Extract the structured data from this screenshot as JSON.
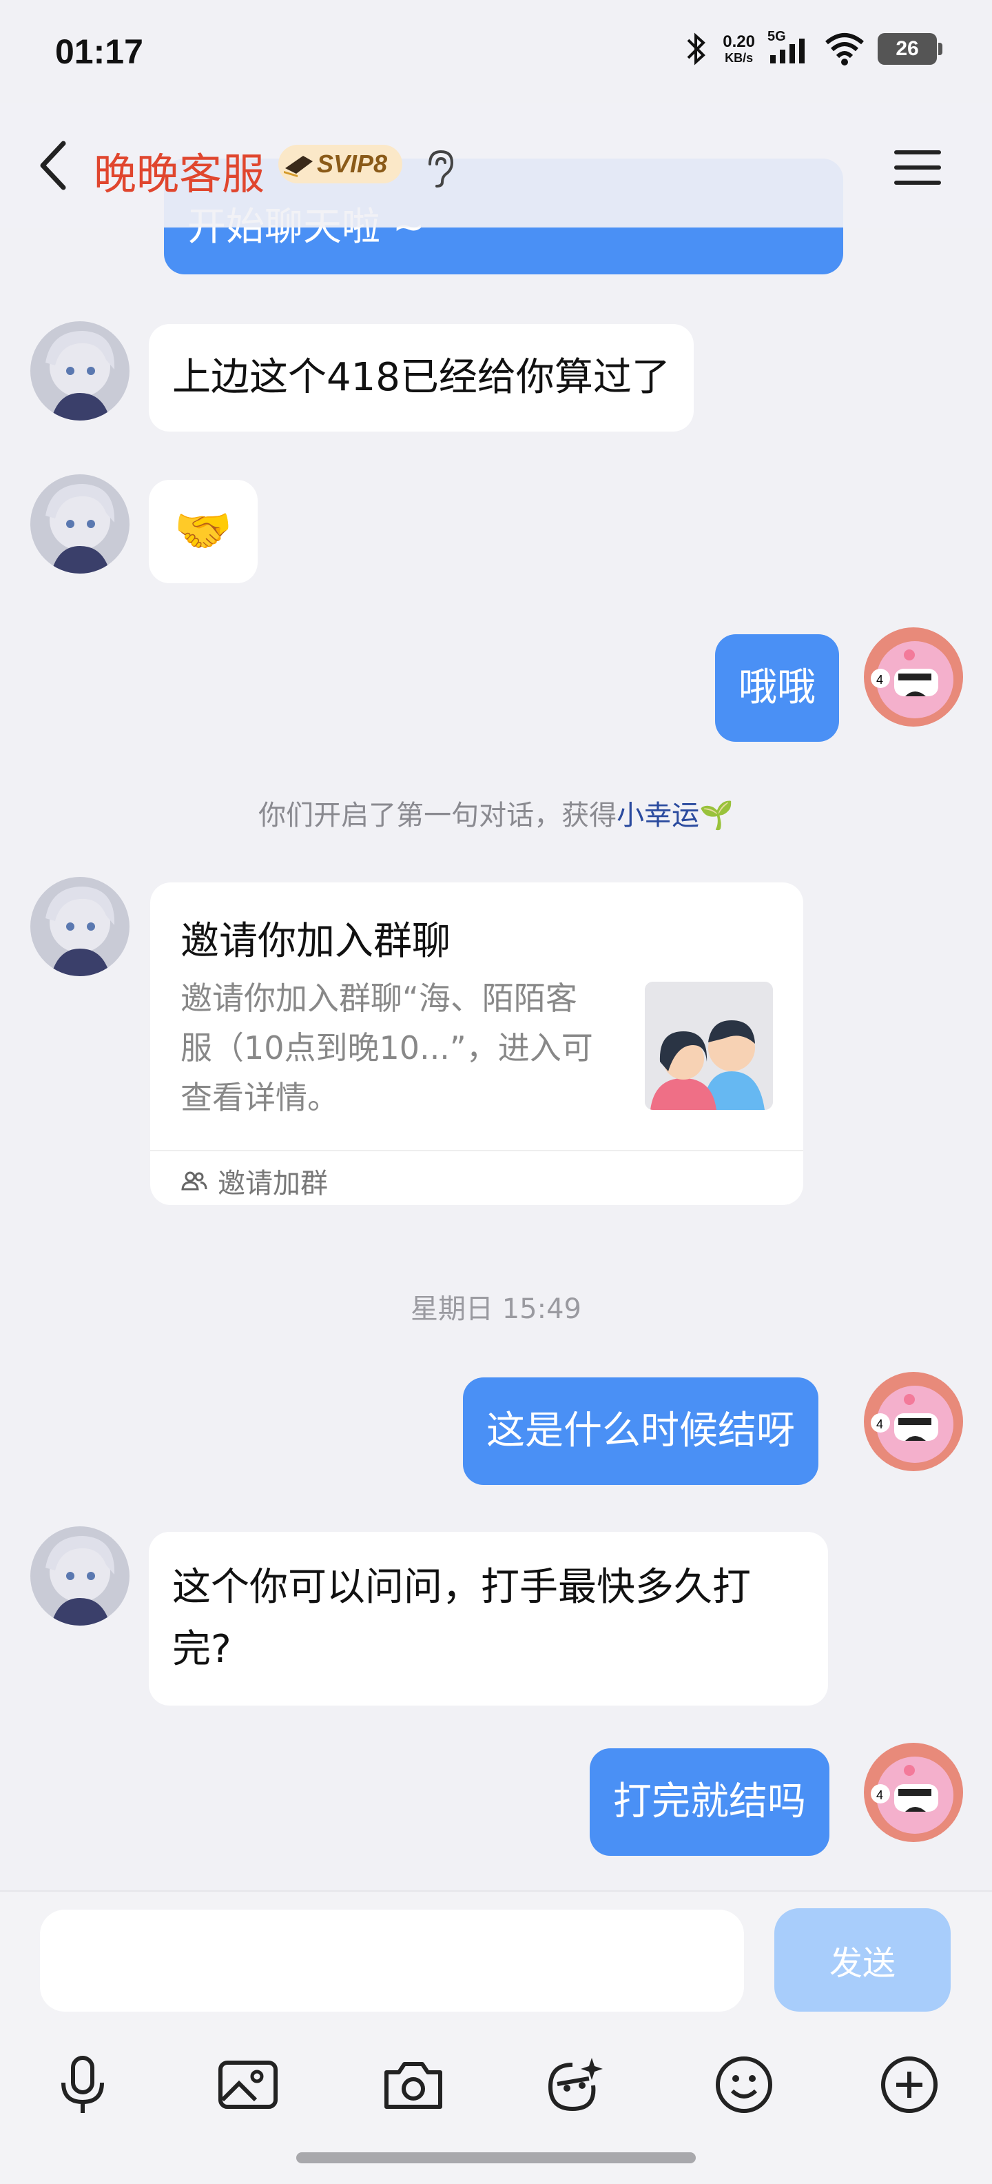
{
  "status": {
    "time": "01:17",
    "net_speed_value": "0.20",
    "net_speed_unit": "KB/s",
    "network": "5G",
    "battery": "26"
  },
  "header": {
    "title": "晚晚客服",
    "badge": "SVIP8"
  },
  "messages": {
    "cut_off": "开始聊天啦 ~",
    "m1": "上边这个418已经给你算过了",
    "m2_emoji": "🤝",
    "m3": "哦哦",
    "system_text": "你们开启了第一句对话，获得",
    "system_lucky": "小幸运",
    "system_emoji": "🌱",
    "card": {
      "title": "邀请你加入群聊",
      "desc": "邀请你加入群聊“海、陌陌客服（10点到晚10...”，进入可查看详情。",
      "footer": "邀请加群"
    },
    "timestamp": "星期日 15:49",
    "m4": "这是什么时候结呀",
    "m5": "这个你可以问问，打手最快多久打完?",
    "m6": "打完就结吗"
  },
  "input": {
    "value": "",
    "send_label": "发送"
  },
  "colors": {
    "bubble_self": "#4a90f5",
    "title_red": "#e0462e",
    "send_disabled": "#a8cdfb"
  },
  "icons": [
    "back-icon",
    "hat-icon",
    "ear-icon",
    "menu-icon",
    "voice-icon",
    "image-icon",
    "camera-icon",
    "sticker-icon",
    "emoji-icon",
    "plus-icon",
    "group-icon"
  ]
}
